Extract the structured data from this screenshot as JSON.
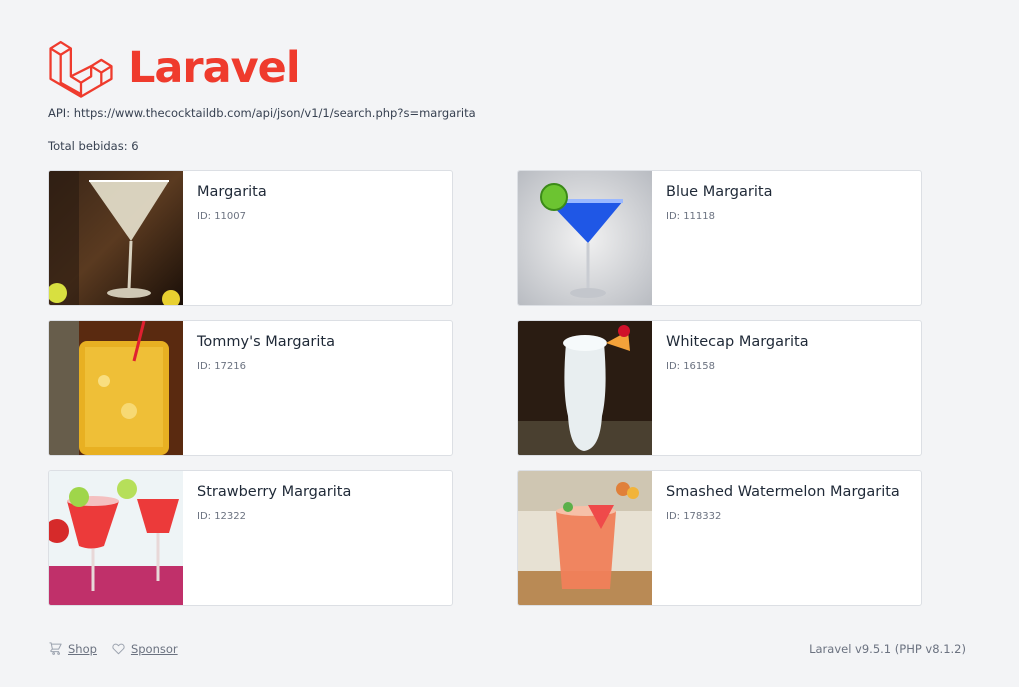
{
  "brand": {
    "name": "Laravel",
    "logo_icon": "laravel-logo-icon",
    "color": "#ef3b2d"
  },
  "api_line": "API: https://www.thecocktaildb.com/api/json/v1/1/search.php?s=margarita",
  "total_line": "Total bebidas: 6",
  "drinks": [
    {
      "name": "Margarita",
      "id_text": "ID: 11007"
    },
    {
      "name": "Blue Margarita",
      "id_text": "ID: 11118"
    },
    {
      "name": "Tommy's Margarita",
      "id_text": "ID: 17216"
    },
    {
      "name": "Whitecap Margarita",
      "id_text": "ID: 16158"
    },
    {
      "name": "Strawberry Margarita",
      "id_text": "ID: 12322"
    },
    {
      "name": "Smashed Watermelon Margarita",
      "id_text": "ID: 178332"
    }
  ],
  "footer": {
    "shop_label": "Shop",
    "shop_icon": "cart-icon",
    "sponsor_label": "Sponsor",
    "sponsor_icon": "heart-icon",
    "version": "Laravel v9.5.1 (PHP v8.1.2)"
  }
}
